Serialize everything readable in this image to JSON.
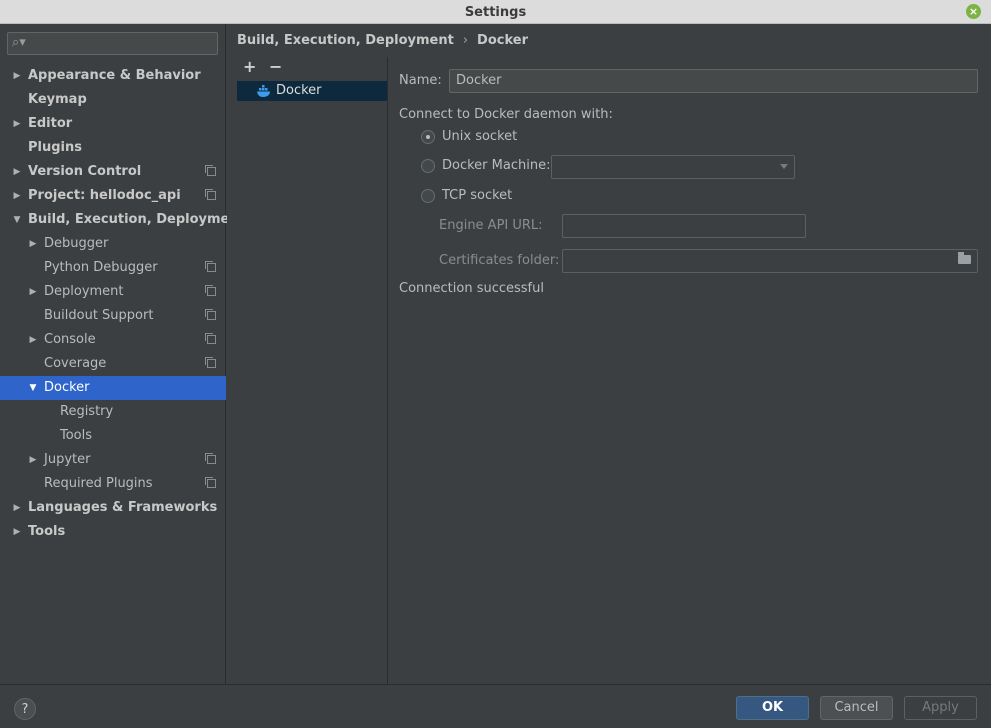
{
  "window": {
    "title": "Settings"
  },
  "search": {
    "placeholder": "",
    "value": ""
  },
  "tree": [
    {
      "label": "Appearance & Behavior",
      "bold": true,
      "level": 0,
      "arrow": "right",
      "copy": false
    },
    {
      "label": "Keymap",
      "bold": true,
      "level": 0,
      "arrow": "",
      "copy": false
    },
    {
      "label": "Editor",
      "bold": true,
      "level": 0,
      "arrow": "right",
      "copy": false
    },
    {
      "label": "Plugins",
      "bold": true,
      "level": 0,
      "arrow": "",
      "copy": false
    },
    {
      "label": "Version Control",
      "bold": true,
      "level": 0,
      "arrow": "right",
      "copy": true
    },
    {
      "label": "Project: hellodoc_api",
      "bold": true,
      "level": 0,
      "arrow": "right",
      "copy": true
    },
    {
      "label": "Build, Execution, Deployment",
      "bold": true,
      "level": 0,
      "arrow": "down",
      "copy": false
    },
    {
      "label": "Debugger",
      "bold": false,
      "level": 1,
      "arrow": "right",
      "copy": false
    },
    {
      "label": "Python Debugger",
      "bold": false,
      "level": 1,
      "arrow": "",
      "copy": true
    },
    {
      "label": "Deployment",
      "bold": false,
      "level": 1,
      "arrow": "right",
      "copy": true
    },
    {
      "label": "Buildout Support",
      "bold": false,
      "level": 1,
      "arrow": "",
      "copy": true
    },
    {
      "label": "Console",
      "bold": false,
      "level": 1,
      "arrow": "right",
      "copy": true
    },
    {
      "label": "Coverage",
      "bold": false,
      "level": 1,
      "arrow": "",
      "copy": true
    },
    {
      "label": "Docker",
      "bold": false,
      "level": 1,
      "arrow": "down",
      "copy": false,
      "selected": true
    },
    {
      "label": "Registry",
      "bold": false,
      "level": 2,
      "arrow": "",
      "copy": false
    },
    {
      "label": "Tools",
      "bold": false,
      "level": 2,
      "arrow": "",
      "copy": false
    },
    {
      "label": "Jupyter",
      "bold": false,
      "level": 1,
      "arrow": "right",
      "copy": true
    },
    {
      "label": "Required Plugins",
      "bold": false,
      "level": 1,
      "arrow": "",
      "copy": true
    },
    {
      "label": "Languages & Frameworks",
      "bold": true,
      "level": 0,
      "arrow": "right",
      "copy": false
    },
    {
      "label": "Tools",
      "bold": true,
      "level": 0,
      "arrow": "right",
      "copy": false
    }
  ],
  "breadcrumb": {
    "parent": "Build, Execution, Deployment",
    "separator": "›",
    "current": "Docker"
  },
  "list": {
    "add": "+",
    "remove": "−",
    "items": [
      "Docker"
    ]
  },
  "form": {
    "name_label": "Name:",
    "name_value": "Docker",
    "connect_label": "Connect to Docker daemon with:",
    "unix_socket": "Unix socket",
    "docker_machine": "Docker Machine:",
    "tcp_socket": "TCP socket",
    "engine_api_url": "Engine API URL:",
    "certificates_folder": "Certificates folder:",
    "status": "Connection successful",
    "selected_option": "unix_socket"
  },
  "footer": {
    "help": "?",
    "ok": "OK",
    "cancel": "Cancel",
    "apply": "Apply"
  },
  "colors": {
    "selection": "#2f65ca",
    "list_selection": "#0d293e",
    "primary_button": "#365880",
    "background": "#3c3f41"
  }
}
